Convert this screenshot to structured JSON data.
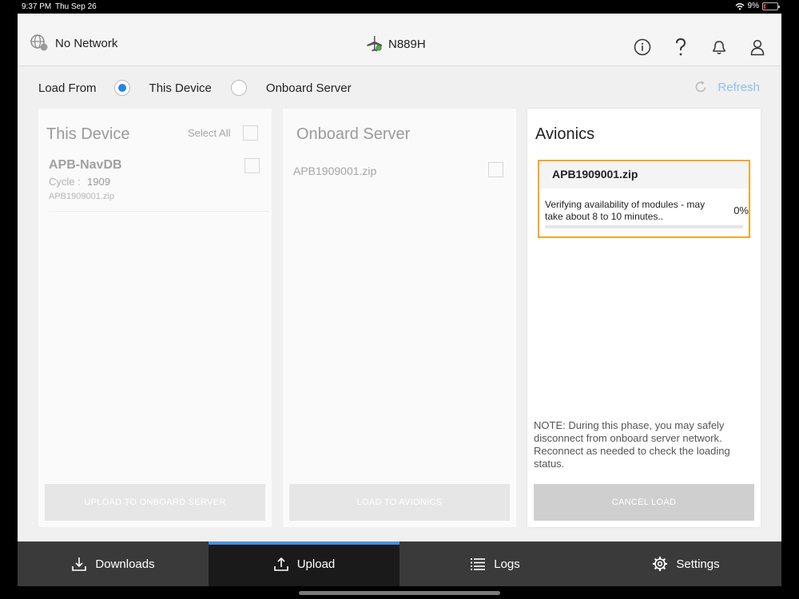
{
  "status_bar": {
    "time": "9:37 PM",
    "date": "Thu Sep 26",
    "battery": "9%"
  },
  "header": {
    "network": "No Network",
    "tail_number": "N889H"
  },
  "load_from": {
    "label": "Load From",
    "options": [
      {
        "label": "This Device",
        "selected": true
      },
      {
        "label": "Onboard Server",
        "selected": false
      }
    ],
    "refresh": "Refresh"
  },
  "this_device": {
    "title": "This Device",
    "select_all": "Select All",
    "item": {
      "name": "APB-NavDB",
      "cycle_label": "Cycle :",
      "cycle_value": "1909",
      "file": "APB1909001.zip"
    },
    "action": "UPLOAD TO ONBOARD SERVER"
  },
  "onboard_server": {
    "title": "Onboard Server",
    "file": "APB1909001.zip",
    "action": "LOAD TO AVIONICS"
  },
  "avionics": {
    "title": "Avionics",
    "card": {
      "file": "APB1909001.zip",
      "message": "Verifying availability of modules - may take about 8 to 10 minutes..",
      "percent_label": "0%",
      "progress": 0
    },
    "note": "NOTE: During this phase, you may safely disconnect from onboard server network. Reconnect as needed to check the loading status.",
    "action": "CANCEL LOAD"
  },
  "nav": {
    "tabs": [
      {
        "label": "Downloads",
        "icon": "download-icon",
        "active": false
      },
      {
        "label": "Upload",
        "icon": "upload-icon",
        "active": true
      },
      {
        "label": "Logs",
        "icon": "list-icon",
        "active": false
      },
      {
        "label": "Settings",
        "icon": "gear-icon",
        "active": false
      }
    ]
  },
  "colors": {
    "accent": "#4a90e2",
    "radio_selected": "#1e88e5",
    "card_border": "#f5a623",
    "refresh": "#8ec1ec"
  }
}
